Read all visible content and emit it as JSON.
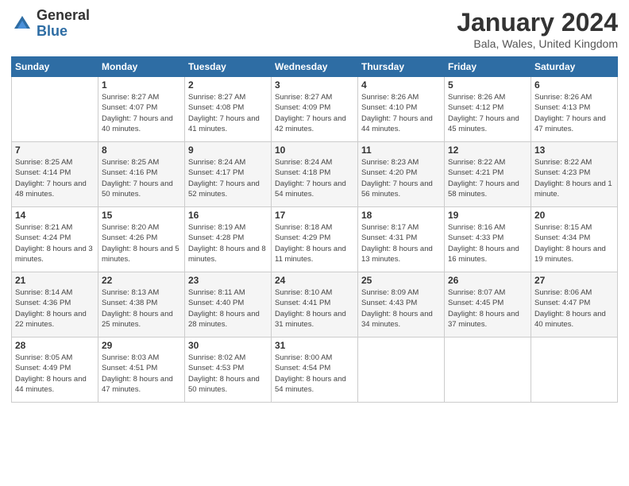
{
  "logo": {
    "general": "General",
    "blue": "Blue"
  },
  "header": {
    "title": "January 2024",
    "location": "Bala, Wales, United Kingdom"
  },
  "weekdays": [
    "Sunday",
    "Monday",
    "Tuesday",
    "Wednesday",
    "Thursday",
    "Friday",
    "Saturday"
  ],
  "weeks": [
    [
      {
        "day": "",
        "sunrise": "",
        "sunset": "",
        "daylight": ""
      },
      {
        "day": "1",
        "sunrise": "Sunrise: 8:27 AM",
        "sunset": "Sunset: 4:07 PM",
        "daylight": "Daylight: 7 hours and 40 minutes."
      },
      {
        "day": "2",
        "sunrise": "Sunrise: 8:27 AM",
        "sunset": "Sunset: 4:08 PM",
        "daylight": "Daylight: 7 hours and 41 minutes."
      },
      {
        "day": "3",
        "sunrise": "Sunrise: 8:27 AM",
        "sunset": "Sunset: 4:09 PM",
        "daylight": "Daylight: 7 hours and 42 minutes."
      },
      {
        "day": "4",
        "sunrise": "Sunrise: 8:26 AM",
        "sunset": "Sunset: 4:10 PM",
        "daylight": "Daylight: 7 hours and 44 minutes."
      },
      {
        "day": "5",
        "sunrise": "Sunrise: 8:26 AM",
        "sunset": "Sunset: 4:12 PM",
        "daylight": "Daylight: 7 hours and 45 minutes."
      },
      {
        "day": "6",
        "sunrise": "Sunrise: 8:26 AM",
        "sunset": "Sunset: 4:13 PM",
        "daylight": "Daylight: 7 hours and 47 minutes."
      }
    ],
    [
      {
        "day": "7",
        "sunrise": "Sunrise: 8:25 AM",
        "sunset": "Sunset: 4:14 PM",
        "daylight": "Daylight: 7 hours and 48 minutes."
      },
      {
        "day": "8",
        "sunrise": "Sunrise: 8:25 AM",
        "sunset": "Sunset: 4:16 PM",
        "daylight": "Daylight: 7 hours and 50 minutes."
      },
      {
        "day": "9",
        "sunrise": "Sunrise: 8:24 AM",
        "sunset": "Sunset: 4:17 PM",
        "daylight": "Daylight: 7 hours and 52 minutes."
      },
      {
        "day": "10",
        "sunrise": "Sunrise: 8:24 AM",
        "sunset": "Sunset: 4:18 PM",
        "daylight": "Daylight: 7 hours and 54 minutes."
      },
      {
        "day": "11",
        "sunrise": "Sunrise: 8:23 AM",
        "sunset": "Sunset: 4:20 PM",
        "daylight": "Daylight: 7 hours and 56 minutes."
      },
      {
        "day": "12",
        "sunrise": "Sunrise: 8:22 AM",
        "sunset": "Sunset: 4:21 PM",
        "daylight": "Daylight: 7 hours and 58 minutes."
      },
      {
        "day": "13",
        "sunrise": "Sunrise: 8:22 AM",
        "sunset": "Sunset: 4:23 PM",
        "daylight": "Daylight: 8 hours and 1 minute."
      }
    ],
    [
      {
        "day": "14",
        "sunrise": "Sunrise: 8:21 AM",
        "sunset": "Sunset: 4:24 PM",
        "daylight": "Daylight: 8 hours and 3 minutes."
      },
      {
        "day": "15",
        "sunrise": "Sunrise: 8:20 AM",
        "sunset": "Sunset: 4:26 PM",
        "daylight": "Daylight: 8 hours and 5 minutes."
      },
      {
        "day": "16",
        "sunrise": "Sunrise: 8:19 AM",
        "sunset": "Sunset: 4:28 PM",
        "daylight": "Daylight: 8 hours and 8 minutes."
      },
      {
        "day": "17",
        "sunrise": "Sunrise: 8:18 AM",
        "sunset": "Sunset: 4:29 PM",
        "daylight": "Daylight: 8 hours and 11 minutes."
      },
      {
        "day": "18",
        "sunrise": "Sunrise: 8:17 AM",
        "sunset": "Sunset: 4:31 PM",
        "daylight": "Daylight: 8 hours and 13 minutes."
      },
      {
        "day": "19",
        "sunrise": "Sunrise: 8:16 AM",
        "sunset": "Sunset: 4:33 PM",
        "daylight": "Daylight: 8 hours and 16 minutes."
      },
      {
        "day": "20",
        "sunrise": "Sunrise: 8:15 AM",
        "sunset": "Sunset: 4:34 PM",
        "daylight": "Daylight: 8 hours and 19 minutes."
      }
    ],
    [
      {
        "day": "21",
        "sunrise": "Sunrise: 8:14 AM",
        "sunset": "Sunset: 4:36 PM",
        "daylight": "Daylight: 8 hours and 22 minutes."
      },
      {
        "day": "22",
        "sunrise": "Sunrise: 8:13 AM",
        "sunset": "Sunset: 4:38 PM",
        "daylight": "Daylight: 8 hours and 25 minutes."
      },
      {
        "day": "23",
        "sunrise": "Sunrise: 8:11 AM",
        "sunset": "Sunset: 4:40 PM",
        "daylight": "Daylight: 8 hours and 28 minutes."
      },
      {
        "day": "24",
        "sunrise": "Sunrise: 8:10 AM",
        "sunset": "Sunset: 4:41 PM",
        "daylight": "Daylight: 8 hours and 31 minutes."
      },
      {
        "day": "25",
        "sunrise": "Sunrise: 8:09 AM",
        "sunset": "Sunset: 4:43 PM",
        "daylight": "Daylight: 8 hours and 34 minutes."
      },
      {
        "day": "26",
        "sunrise": "Sunrise: 8:07 AM",
        "sunset": "Sunset: 4:45 PM",
        "daylight": "Daylight: 8 hours and 37 minutes."
      },
      {
        "day": "27",
        "sunrise": "Sunrise: 8:06 AM",
        "sunset": "Sunset: 4:47 PM",
        "daylight": "Daylight: 8 hours and 40 minutes."
      }
    ],
    [
      {
        "day": "28",
        "sunrise": "Sunrise: 8:05 AM",
        "sunset": "Sunset: 4:49 PM",
        "daylight": "Daylight: 8 hours and 44 minutes."
      },
      {
        "day": "29",
        "sunrise": "Sunrise: 8:03 AM",
        "sunset": "Sunset: 4:51 PM",
        "daylight": "Daylight: 8 hours and 47 minutes."
      },
      {
        "day": "30",
        "sunrise": "Sunrise: 8:02 AM",
        "sunset": "Sunset: 4:53 PM",
        "daylight": "Daylight: 8 hours and 50 minutes."
      },
      {
        "day": "31",
        "sunrise": "Sunrise: 8:00 AM",
        "sunset": "Sunset: 4:54 PM",
        "daylight": "Daylight: 8 hours and 54 minutes."
      },
      {
        "day": "",
        "sunrise": "",
        "sunset": "",
        "daylight": ""
      },
      {
        "day": "",
        "sunrise": "",
        "sunset": "",
        "daylight": ""
      },
      {
        "day": "",
        "sunrise": "",
        "sunset": "",
        "daylight": ""
      }
    ]
  ]
}
